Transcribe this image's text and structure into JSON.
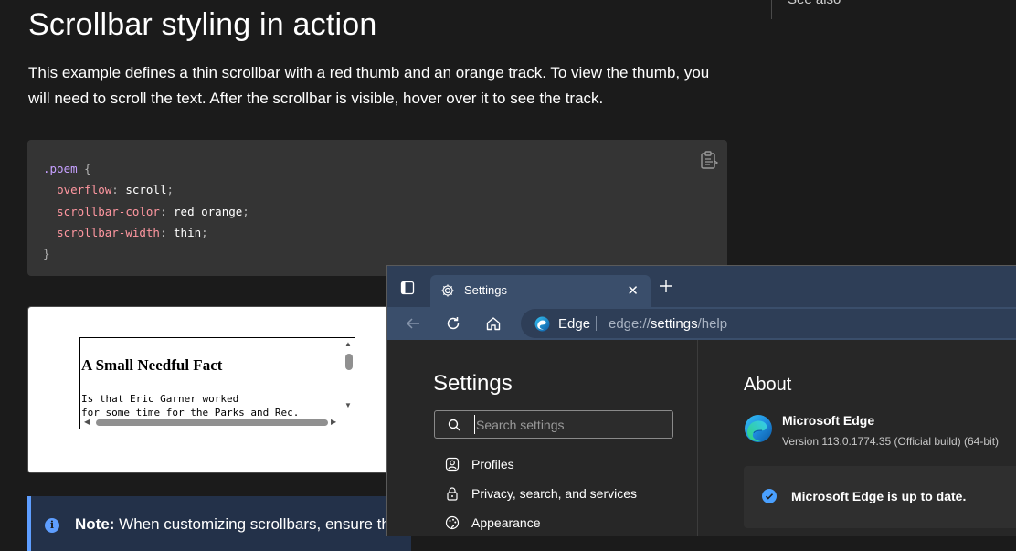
{
  "mdn": {
    "title": "Scrollbar styling in action",
    "intro": "This example defines a thin scrollbar with a red thumb and an orange track. To view the thumb, you will need to scroll the text. After the scrollbar is visible, hover over it to see the track.",
    "toc_item": "See also",
    "code": {
      "selector": ".poem",
      "open_brace": " {",
      "decl1_prop": "overflow",
      "decl1_val": "scroll",
      "decl2_prop": "scrollbar-color",
      "decl2_val": "red orange",
      "decl3_prop": "scrollbar-width",
      "decl3_val": "thin",
      "close_brace": "}"
    },
    "example": {
      "poem_title": "A Small Needful Fact",
      "line1": "Is that Eric Garner worked",
      "line2": "for some time for the Parks and Rec."
    },
    "note": {
      "label": "Note:",
      "text": " When customizing scrollbars, ensure th"
    }
  },
  "edge": {
    "tab_title": "Settings",
    "tab_close": "✕",
    "omnibox_site": "Edge",
    "url_prefix": "edge://",
    "url_host": "settings",
    "url_path": "/help",
    "settings": {
      "title": "Settings",
      "search_placeholder": "Search settings",
      "items": [
        {
          "label": "Profiles",
          "icon": "profile-icon"
        },
        {
          "label": "Privacy, search, and services",
          "icon": "lock-icon"
        },
        {
          "label": "Appearance",
          "icon": "appearance-icon"
        }
      ]
    },
    "about": {
      "title": "About",
      "product": "Microsoft Edge",
      "version": "Version 113.0.1774.35 (Official build) (64-bit)",
      "status": "Microsoft Edge is up to date."
    },
    "colors": {
      "tabstrip": "#2e3e57",
      "toolbar": "#3a4e6b",
      "status_check": "#4aa0ff"
    }
  }
}
